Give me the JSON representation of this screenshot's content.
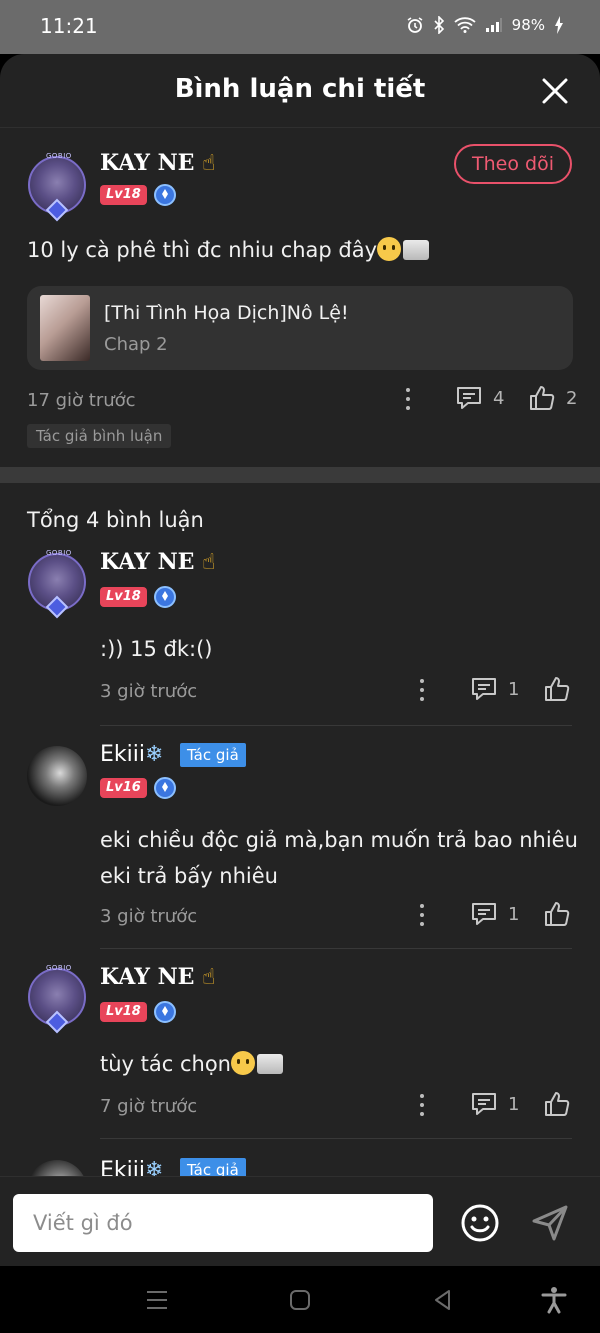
{
  "status_bar": {
    "time": "11:21",
    "battery": "98%"
  },
  "sheet": {
    "title": "Bình luận chi tiết"
  },
  "main_comment": {
    "username": "KAY NE",
    "level": "Lv18",
    "follow_label": "Theo dõi",
    "text": "10 ly cà phê thì đc nhiu chap đây",
    "chapter": {
      "title": "[Thi Tình Họa Dịch]Nô Lệ!",
      "subtitle": "Chap 2"
    },
    "time": "17 giờ trước",
    "reply_count": "4",
    "like_count": "2",
    "author_comment_tag": "Tác giả bình luận"
  },
  "replies_section": {
    "total_label": "Tổng 4 bình luận"
  },
  "replies": [
    {
      "username": "KAY NE",
      "level": "Lv18",
      "text": ":))  15 đk:()",
      "time": "3 giờ trước",
      "reply_count": "1"
    },
    {
      "username": "Ekiii",
      "author_tag": "Tác giả",
      "level": "Lv16",
      "text_line1": "eki chiều độc giả mà,bạn muốn trả bao nhiêu",
      "text_line2": "eki trả bấy nhiêu",
      "time": "3 giờ trước",
      "reply_count": "1"
    },
    {
      "username": "KAY NE",
      "level": "Lv18",
      "text": "tùy tác chọn",
      "time": "7 giờ trước",
      "reply_count": "1"
    },
    {
      "username": "Ekiii",
      "author_tag": "Tác giả"
    }
  ],
  "input": {
    "placeholder": "Viết gì đó"
  },
  "icons": {
    "close": "close-icon",
    "more": "more-vert-icon",
    "comment": "comment-icon",
    "like": "thumbs-up-icon",
    "emoji": "emoji-icon",
    "send": "send-icon",
    "pointing_hand": "☝",
    "snowflake": "❄"
  },
  "colors": {
    "accent_red": "#e9516a",
    "author_blue": "#3d8fe8",
    "background": "#232323"
  }
}
